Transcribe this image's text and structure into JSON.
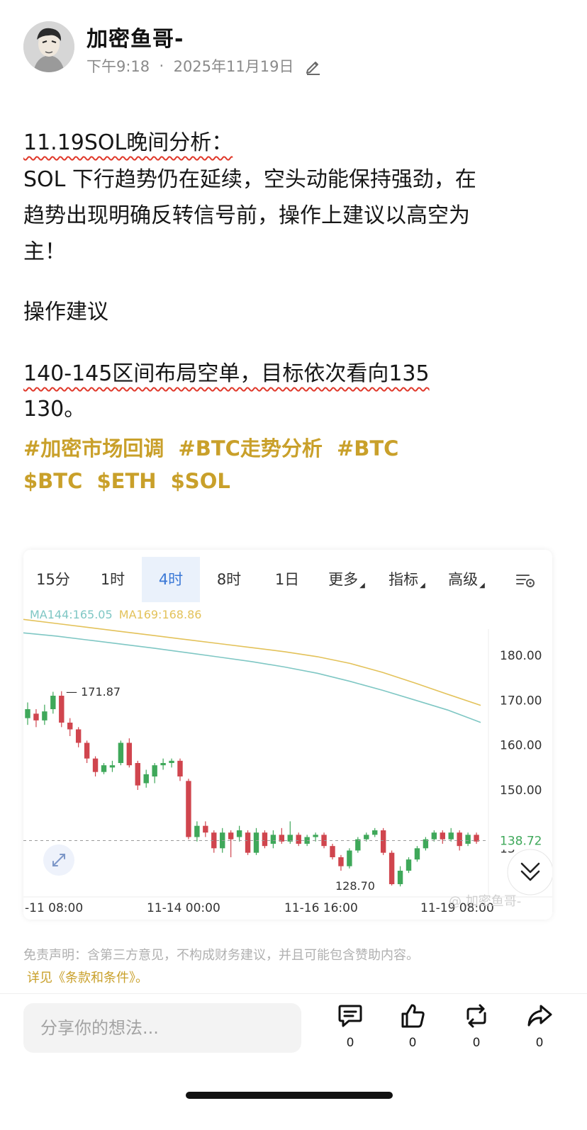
{
  "post": {
    "author": "加密鱼哥-",
    "time": "下午9:18",
    "date": "2025年11月19日",
    "avatar_icon": "avatar-illustration",
    "lines": {
      "title": "11.19SOL晚间分析：",
      "l1": "SOL 下行趋势仍在延续，空头动能保持强劲，在",
      "l2": "趋势出现明确反转信号前，操作上建议以高空为",
      "l3": "主！",
      "op_heading": "操作建议",
      "op_line1": "140-145区间布局空单，目标依次看向135",
      "op_line2": "130。"
    },
    "hashtags": [
      "#加密市场回调",
      "#BTC走势分析",
      "#BTC"
    ],
    "cashtags": [
      "$BTC",
      "$ETH",
      "$SOL"
    ],
    "accent_color": "#c9a02a"
  },
  "chart": {
    "tabs": [
      {
        "label": "15分",
        "active": false
      },
      {
        "label": "1时",
        "active": false
      },
      {
        "label": "4时",
        "active": true
      },
      {
        "label": "8时",
        "active": false
      },
      {
        "label": "1日",
        "active": false
      },
      {
        "label": "更多",
        "active": false
      },
      {
        "label": "指标",
        "active": false
      },
      {
        "label": "高级",
        "active": false
      }
    ],
    "settings_icon": "chart-settings-icon",
    "ma_legend": {
      "ma144": "MA144:165.05",
      "ma169": "MA169:168.86"
    },
    "watermark": "加密鱼哥-",
    "colors": {
      "up": "#3fa85a",
      "down": "#d0454e",
      "ma144": "#7fc7c4",
      "ma169": "#e3c25a",
      "active_tab": "#3a78d6"
    }
  },
  "chart_data": {
    "type": "candlestick",
    "timeframe": "4时",
    "y_ticks": [
      "180.00",
      "170.00",
      "160.00",
      "150.00",
      "13"
    ],
    "x_ticks": [
      "-11 08:00",
      "11-14 00:00",
      "11-16 16:00",
      "11-19 08:00"
    ],
    "ylim": [
      124,
      188
    ],
    "current_price": "138.72",
    "annotations": {
      "high": "171.87",
      "low": "128.70"
    },
    "ma144": [
      185.0,
      184.3,
      183.4,
      182.5,
      181.6,
      180.6,
      179.6,
      178.6,
      177.4,
      176.0,
      174.2,
      172.2,
      170.0,
      167.8,
      165.05
    ],
    "ma169": [
      188.0,
      187.1,
      186.2,
      185.3,
      184.4,
      183.5,
      182.6,
      181.7,
      180.8,
      179.7,
      178.2,
      176.2,
      173.8,
      171.3,
      168.86
    ],
    "candles": [
      [
        166,
        168,
        169.5,
        164.5
      ],
      [
        167,
        165.5,
        168,
        164
      ],
      [
        165.5,
        167.5,
        169,
        164.5
      ],
      [
        168,
        171,
        171.87,
        167
      ],
      [
        171,
        165,
        172,
        164
      ],
      [
        165,
        163.5,
        166,
        162
      ],
      [
        163.5,
        160.5,
        164,
        159.5
      ],
      [
        160.5,
        157,
        161,
        156
      ],
      [
        157,
        154,
        157.5,
        153
      ],
      [
        154,
        155.5,
        156,
        153.5
      ],
      [
        155,
        155.5,
        156.5,
        154
      ],
      [
        156,
        160.5,
        161,
        155.5
      ],
      [
        160.5,
        155.5,
        161.5,
        155
      ],
      [
        156,
        151,
        156.5,
        150
      ],
      [
        151.5,
        153.5,
        154.5,
        150.5
      ],
      [
        153,
        155.5,
        156,
        151.5
      ],
      [
        155.5,
        156,
        157,
        154.5
      ],
      [
        156,
        156.5,
        157,
        155
      ],
      [
        156.5,
        153,
        157,
        152
      ],
      [
        152,
        139.5,
        152.5,
        139
      ],
      [
        139.5,
        142,
        143,
        138.5
      ],
      [
        142,
        140.5,
        143,
        139.5
      ],
      [
        140.5,
        137,
        141,
        136
      ],
      [
        137,
        140.5,
        141.5,
        136
      ],
      [
        140.5,
        139,
        141,
        135
      ],
      [
        139.5,
        141,
        142,
        138.5
      ],
      [
        140.5,
        136,
        141,
        135.5
      ],
      [
        136,
        140.5,
        141.5,
        135.5
      ],
      [
        140.5,
        137.5,
        141,
        137
      ],
      [
        138,
        140,
        141,
        137
      ],
      [
        140,
        138.5,
        141.5,
        138
      ],
      [
        138.5,
        140,
        143,
        138
      ],
      [
        140,
        138,
        140.5,
        137.5
      ],
      [
        138,
        139.5,
        140,
        137.5
      ],
      [
        139.5,
        140,
        140.5,
        138.5
      ],
      [
        140,
        137.5,
        140.5,
        137
      ],
      [
        137.5,
        135,
        138,
        134.5
      ],
      [
        135,
        133,
        135.5,
        132
      ],
      [
        133,
        136.5,
        137,
        132.5
      ],
      [
        136.5,
        139,
        139.5,
        136
      ],
      [
        139,
        140,
        140.5,
        138.5
      ],
      [
        140,
        141,
        141.5,
        139.5
      ],
      [
        141,
        136,
        141.5,
        135.5
      ],
      [
        136,
        129,
        136.5,
        128.7
      ],
      [
        129,
        132,
        133,
        128.5
      ],
      [
        132,
        134.5,
        135,
        131.5
      ],
      [
        134.5,
        137,
        137.5,
        134
      ],
      [
        137,
        139,
        139.5,
        136.5
      ],
      [
        139,
        140.5,
        141,
        138.5
      ],
      [
        140.5,
        139,
        141,
        138
      ],
      [
        139,
        140.5,
        141.5,
        138.5
      ],
      [
        140.5,
        137.5,
        141,
        136.5
      ],
      [
        138,
        140,
        140.5,
        137.5
      ],
      [
        140,
        138.5,
        140.5,
        138
      ]
    ]
  },
  "footer": {
    "disclaimer": "免责声明：含第三方意见，不构成财务建议，并且可能包含赞助内容。",
    "terms": "详见《条款和条件》。",
    "comment_placeholder": "分享你的想法...",
    "actions": [
      {
        "name": "comment",
        "icon": "comment-icon",
        "count": "0"
      },
      {
        "name": "like",
        "icon": "thumbs-up-icon",
        "count": "0"
      },
      {
        "name": "repost",
        "icon": "repost-icon",
        "count": "0"
      },
      {
        "name": "share",
        "icon": "share-icon",
        "count": "0"
      }
    ]
  }
}
